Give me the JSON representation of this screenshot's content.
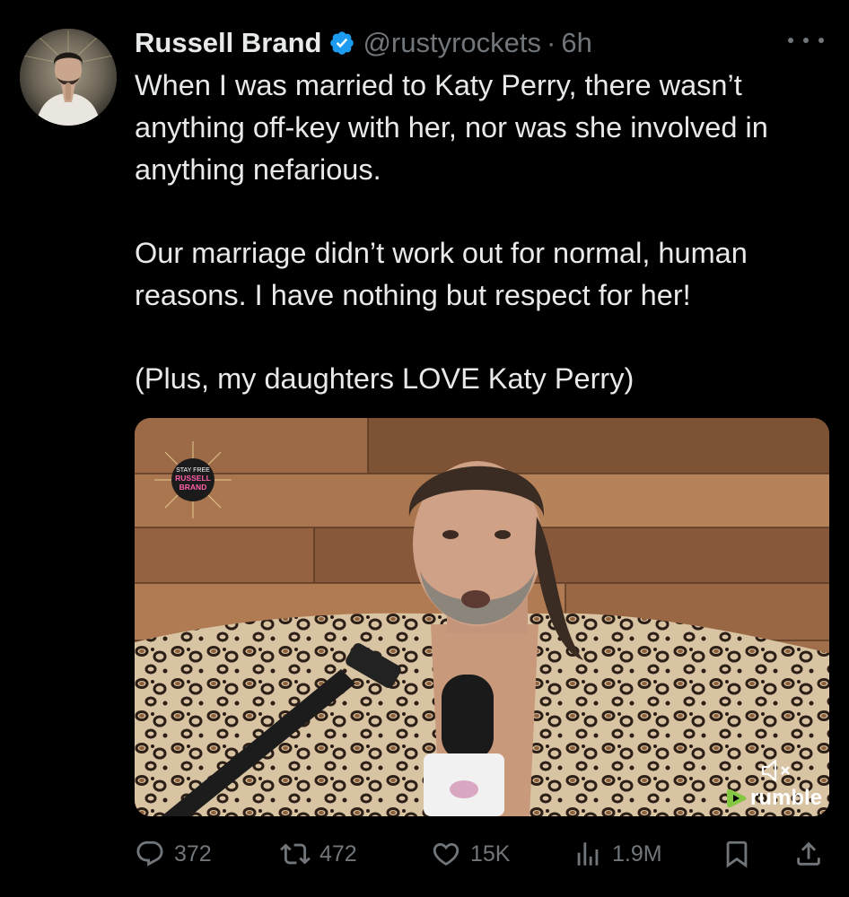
{
  "tweet": {
    "author": {
      "display_name": "Russell Brand",
      "handle": "@rustyrockets",
      "verified_icon": "verified-badge-icon",
      "avatar": "avatar-photo"
    },
    "separator": "·",
    "time": "6h",
    "more_icon": "more-icon",
    "text": {
      "p1": "When I was married to Katy Perry, there wasn’t anything off-key with her, nor was she involved in anything nefarious.",
      "p2": "Our marriage didn’t work out for normal, human reasons. I have nothing but respect for her!",
      "p3": "(Plus, my daughters LOVE Katy Perry)"
    },
    "media": {
      "type": "video",
      "overlay_logo_lines": [
        "STAY FREE",
        "RUSSELL",
        "BRAND"
      ],
      "mute_icon": "speaker-muted-icon",
      "provider": "rumble"
    },
    "actions": {
      "replies": "372",
      "retweets": "472",
      "likes": "15K",
      "views": "1.9M",
      "bookmark_icon": "bookmark-icon",
      "share_icon": "share-icon"
    }
  },
  "colors": {
    "background": "#000000",
    "primary_text": "#e7e9ea",
    "secondary_text": "#71767b",
    "verified_blue": "#1d9bf0",
    "rumble_green": "#85c742"
  }
}
